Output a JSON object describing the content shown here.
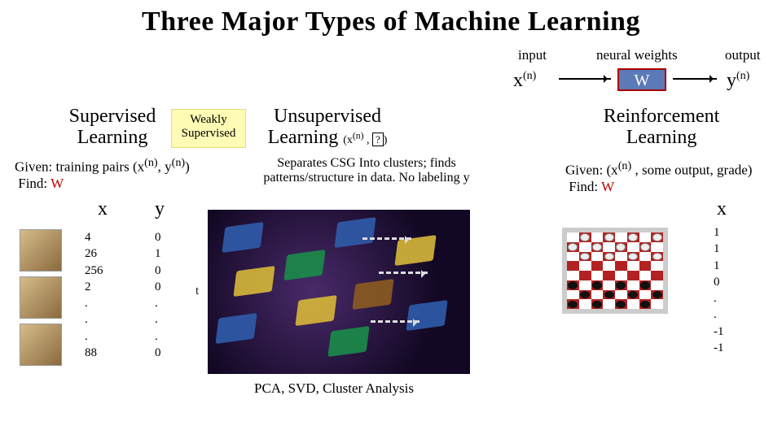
{
  "title": "Three Major Types of Machine Learning",
  "diagram": {
    "label_input": "input",
    "label_weights": "neural weights",
    "label_output": "output",
    "x": "x",
    "x_sup": "(n)",
    "w": "W",
    "y": "y",
    "y_sup": "(n)"
  },
  "sections": {
    "supervised": {
      "title": "Supervised Learning",
      "given_prefix": "Given: training pairs (x",
      "given_mid": ", y",
      "given_suffix": ")",
      "sup_n": "(n)",
      "find_label": "Find: ",
      "find_target": "W"
    },
    "weakly": {
      "line1": "Weakly",
      "line2": "Supervised"
    },
    "unsupervised": {
      "title": "Unsupervised Learning",
      "paren_prefix": "(x",
      "paren_sup": "(n)",
      "paren_comma": " , ",
      "paren_q": "?",
      "paren_close": ")",
      "sub": "Separates CSG Into clusters; finds patterns/structure in data. No labeling y",
      "t_label": "t",
      "caption": "PCA, SVD, Cluster Analysis"
    },
    "reinforcement": {
      "title": "Reinforcement Learning",
      "given_prefix": "Given: (x",
      "given_sup": "(n)",
      "given_suffix": " , some output, grade)",
      "find_label": "Find: ",
      "find_target": "W"
    }
  },
  "table": {
    "x_head": "x",
    "y_head": "y",
    "x_values": [
      "4",
      "26",
      "256",
      "2",
      ".",
      ".",
      ".",
      "88"
    ],
    "y_values": [
      "0",
      "1",
      "0",
      "0",
      ".",
      ".",
      ".",
      "0"
    ]
  },
  "rl": {
    "x_head": "x",
    "vector": [
      "1",
      "1",
      "1",
      "0",
      ".",
      ".",
      "-1",
      "-1"
    ]
  }
}
